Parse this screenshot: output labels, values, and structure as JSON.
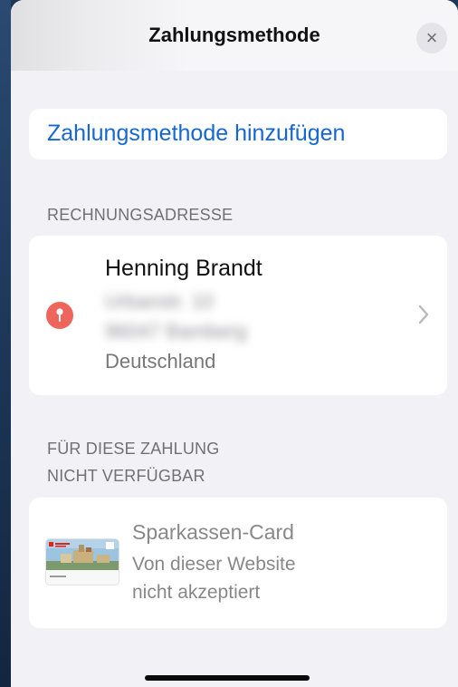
{
  "sheet": {
    "title": "Zahlungsmethode",
    "close_symbol": "×"
  },
  "add_payment": {
    "label": "Zahlungsmethode hinzufügen"
  },
  "billing": {
    "header": "RECHNUNGSADRESSE",
    "name": "Henning Brandt",
    "street_redacted": "Urbanstr. 10",
    "city_redacted": "96047 Bamberg",
    "country": "Deutschland",
    "icon": "location-pin-icon",
    "icon_color": "#ee665b"
  },
  "unavailable": {
    "header_line1": "FÜR DIESE ZAHLUNG",
    "header_line2": "NICHT VERFÜGBAR",
    "card_name": "Sparkassen-Card",
    "note_line1": "Von dieser Website",
    "note_line2": "nicht akzeptiert"
  },
  "colors": {
    "accent": "#1566d6",
    "background": "#f2f2f6",
    "card": "#ffffff",
    "secondary_text": "#707075"
  }
}
